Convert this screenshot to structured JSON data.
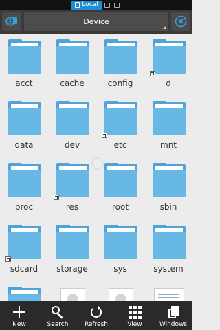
{
  "sources": {
    "active_label": "Local"
  },
  "toolbar": {
    "path_label": "Device"
  },
  "folders": [
    {
      "name": "acct",
      "symlink": false
    },
    {
      "name": "cache",
      "symlink": false
    },
    {
      "name": "config",
      "symlink": false
    },
    {
      "name": "d",
      "symlink": true
    },
    {
      "name": "data",
      "symlink": false
    },
    {
      "name": "dev",
      "symlink": false
    },
    {
      "name": "etc",
      "symlink": true
    },
    {
      "name": "mnt",
      "symlink": false
    },
    {
      "name": "proc",
      "symlink": false
    },
    {
      "name": "res",
      "symlink": true
    },
    {
      "name": "root",
      "symlink": false
    },
    {
      "name": "sbin",
      "symlink": false
    },
    {
      "name": "sdcard",
      "symlink": true
    },
    {
      "name": "storage",
      "symlink": false
    },
    {
      "name": "sys",
      "symlink": false
    },
    {
      "name": "system",
      "symlink": false
    }
  ],
  "bottom_bar": {
    "new_label": "New",
    "search_label": "Search",
    "refresh_label": "Refresh",
    "view_label": "View",
    "windows_label": "Windows"
  },
  "colors": {
    "accent": "#1f8fd3",
    "folder": "#4fa3d8",
    "toolbar": "#3a3a3a"
  }
}
